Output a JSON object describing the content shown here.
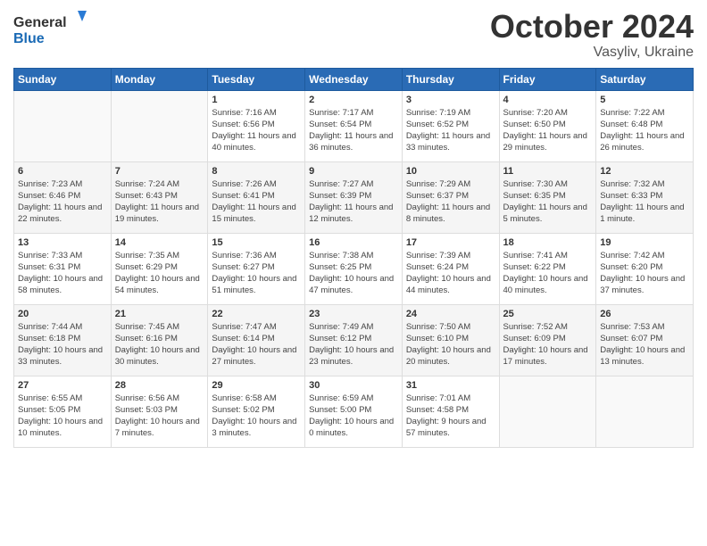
{
  "header": {
    "logo_line1": "General",
    "logo_line2": "Blue",
    "month": "October 2024",
    "location": "Vasyliv, Ukraine"
  },
  "days_of_week": [
    "Sunday",
    "Monday",
    "Tuesday",
    "Wednesday",
    "Thursday",
    "Friday",
    "Saturday"
  ],
  "weeks": [
    [
      {
        "day": "",
        "info": ""
      },
      {
        "day": "",
        "info": ""
      },
      {
        "day": "1",
        "info": "Sunrise: 7:16 AM\nSunset: 6:56 PM\nDaylight: 11 hours and 40 minutes."
      },
      {
        "day": "2",
        "info": "Sunrise: 7:17 AM\nSunset: 6:54 PM\nDaylight: 11 hours and 36 minutes."
      },
      {
        "day": "3",
        "info": "Sunrise: 7:19 AM\nSunset: 6:52 PM\nDaylight: 11 hours and 33 minutes."
      },
      {
        "day": "4",
        "info": "Sunrise: 7:20 AM\nSunset: 6:50 PM\nDaylight: 11 hours and 29 minutes."
      },
      {
        "day": "5",
        "info": "Sunrise: 7:22 AM\nSunset: 6:48 PM\nDaylight: 11 hours and 26 minutes."
      }
    ],
    [
      {
        "day": "6",
        "info": "Sunrise: 7:23 AM\nSunset: 6:46 PM\nDaylight: 11 hours and 22 minutes."
      },
      {
        "day": "7",
        "info": "Sunrise: 7:24 AM\nSunset: 6:43 PM\nDaylight: 11 hours and 19 minutes."
      },
      {
        "day": "8",
        "info": "Sunrise: 7:26 AM\nSunset: 6:41 PM\nDaylight: 11 hours and 15 minutes."
      },
      {
        "day": "9",
        "info": "Sunrise: 7:27 AM\nSunset: 6:39 PM\nDaylight: 11 hours and 12 minutes."
      },
      {
        "day": "10",
        "info": "Sunrise: 7:29 AM\nSunset: 6:37 PM\nDaylight: 11 hours and 8 minutes."
      },
      {
        "day": "11",
        "info": "Sunrise: 7:30 AM\nSunset: 6:35 PM\nDaylight: 11 hours and 5 minutes."
      },
      {
        "day": "12",
        "info": "Sunrise: 7:32 AM\nSunset: 6:33 PM\nDaylight: 11 hours and 1 minute."
      }
    ],
    [
      {
        "day": "13",
        "info": "Sunrise: 7:33 AM\nSunset: 6:31 PM\nDaylight: 10 hours and 58 minutes."
      },
      {
        "day": "14",
        "info": "Sunrise: 7:35 AM\nSunset: 6:29 PM\nDaylight: 10 hours and 54 minutes."
      },
      {
        "day": "15",
        "info": "Sunrise: 7:36 AM\nSunset: 6:27 PM\nDaylight: 10 hours and 51 minutes."
      },
      {
        "day": "16",
        "info": "Sunrise: 7:38 AM\nSunset: 6:25 PM\nDaylight: 10 hours and 47 minutes."
      },
      {
        "day": "17",
        "info": "Sunrise: 7:39 AM\nSunset: 6:24 PM\nDaylight: 10 hours and 44 minutes."
      },
      {
        "day": "18",
        "info": "Sunrise: 7:41 AM\nSunset: 6:22 PM\nDaylight: 10 hours and 40 minutes."
      },
      {
        "day": "19",
        "info": "Sunrise: 7:42 AM\nSunset: 6:20 PM\nDaylight: 10 hours and 37 minutes."
      }
    ],
    [
      {
        "day": "20",
        "info": "Sunrise: 7:44 AM\nSunset: 6:18 PM\nDaylight: 10 hours and 33 minutes."
      },
      {
        "day": "21",
        "info": "Sunrise: 7:45 AM\nSunset: 6:16 PM\nDaylight: 10 hours and 30 minutes."
      },
      {
        "day": "22",
        "info": "Sunrise: 7:47 AM\nSunset: 6:14 PM\nDaylight: 10 hours and 27 minutes."
      },
      {
        "day": "23",
        "info": "Sunrise: 7:49 AM\nSunset: 6:12 PM\nDaylight: 10 hours and 23 minutes."
      },
      {
        "day": "24",
        "info": "Sunrise: 7:50 AM\nSunset: 6:10 PM\nDaylight: 10 hours and 20 minutes."
      },
      {
        "day": "25",
        "info": "Sunrise: 7:52 AM\nSunset: 6:09 PM\nDaylight: 10 hours and 17 minutes."
      },
      {
        "day": "26",
        "info": "Sunrise: 7:53 AM\nSunset: 6:07 PM\nDaylight: 10 hours and 13 minutes."
      }
    ],
    [
      {
        "day": "27",
        "info": "Sunrise: 6:55 AM\nSunset: 5:05 PM\nDaylight: 10 hours and 10 minutes."
      },
      {
        "day": "28",
        "info": "Sunrise: 6:56 AM\nSunset: 5:03 PM\nDaylight: 10 hours and 7 minutes."
      },
      {
        "day": "29",
        "info": "Sunrise: 6:58 AM\nSunset: 5:02 PM\nDaylight: 10 hours and 3 minutes."
      },
      {
        "day": "30",
        "info": "Sunrise: 6:59 AM\nSunset: 5:00 PM\nDaylight: 10 hours and 0 minutes."
      },
      {
        "day": "31",
        "info": "Sunrise: 7:01 AM\nSunset: 4:58 PM\nDaylight: 9 hours and 57 minutes."
      },
      {
        "day": "",
        "info": ""
      },
      {
        "day": "",
        "info": ""
      }
    ]
  ]
}
